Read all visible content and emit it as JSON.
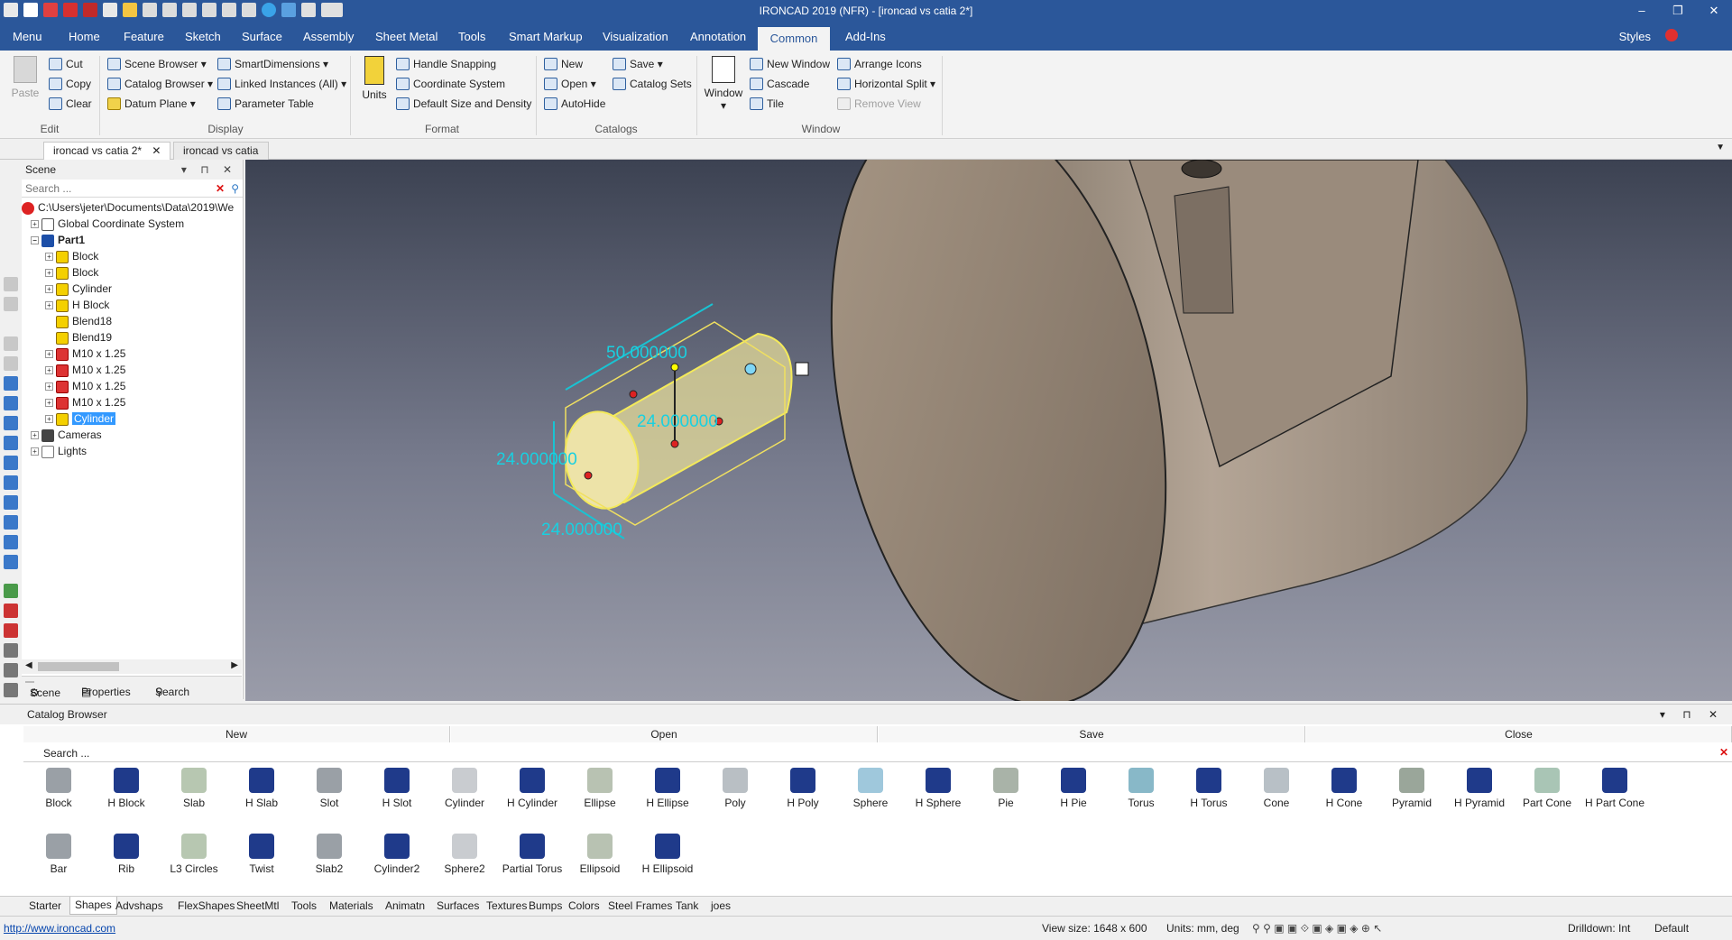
{
  "window": {
    "title": "IRONCAD 2019 (NFR) - [ironcad vs catia 2*]",
    "controls": [
      "–",
      "❐",
      "✕"
    ]
  },
  "menu": {
    "tabs": [
      "Menu",
      "Home",
      "Feature",
      "Sketch",
      "Surface",
      "Assembly",
      "Sheet Metal",
      "Tools",
      "Smart Markup",
      "Visualization",
      "Annotation",
      "Common",
      "Add-Ins"
    ],
    "active": "Common",
    "styles": "Styles"
  },
  "ribbon": {
    "edit": {
      "paste": "Paste",
      "cut": "Cut",
      "copy": "Copy",
      "clear": "Clear",
      "label": "Edit"
    },
    "display": {
      "scene_browser": "Scene Browser",
      "catalog_browser": "Catalog Browser",
      "datum_plane": "Datum Plane",
      "smart_dimensions": "SmartDimensions",
      "linked_instances": "Linked Instances (All)",
      "parameter_table": "Parameter Table",
      "label": "Display"
    },
    "format": {
      "units": "Units",
      "handle_snapping": "Handle Snapping",
      "coordinate_system": "Coordinate System",
      "default_size": "Default Size and Density",
      "label": "Format"
    },
    "catalogs": {
      "new": "New",
      "open": "Open",
      "autohide": "AutoHide",
      "save": "Save",
      "catalog_sets": "Catalog Sets",
      "label": "Catalogs"
    },
    "window": {
      "window": "Window",
      "new_window": "New Window",
      "cascade": "Cascade",
      "tile": "Tile",
      "arrange_icons": "Arrange Icons",
      "horizontal_split": "Horizontal Split",
      "remove_view": "Remove View",
      "label": "Window"
    }
  },
  "doc_tabs": [
    "ironcad vs catia 2*",
    "ironcad vs catia"
  ],
  "scene": {
    "title": "Scene",
    "search_placeholder": "Search ...",
    "root": "C:\\Users\\jeter\\Documents\\Data\\2019\\We",
    "gcs": "Global Coordinate System",
    "part": "Part1",
    "items": [
      "Block",
      "Block",
      "Cylinder",
      "H Block",
      "Blend18",
      "Blend19",
      "M10 x 1.25",
      "M10 x 1.25",
      "M10 x 1.25",
      "M10 x 1.25"
    ],
    "selected": "Cylinder",
    "cameras": "Cameras",
    "lights": "Lights",
    "tabs": {
      "scene": "Scene",
      "properties": "Properties",
      "search": "Search"
    }
  },
  "viewport": {
    "dim_length": "50.000000",
    "dim_height": "24.000000",
    "dim_width": "24.000000",
    "dim_center": "24.000000"
  },
  "catalog": {
    "title": "Catalog Browser",
    "buttons": [
      "New",
      "Open",
      "Save",
      "Close"
    ],
    "search": "Search ...",
    "row1": [
      "Block",
      "H Block",
      "Slab",
      "H Slab",
      "Slot",
      "H Slot",
      "Cylinder",
      "H Cylinder",
      "Ellipse",
      "H Ellipse",
      "Poly",
      "H Poly",
      "Sphere",
      "H Sphere",
      "Pie",
      "H Pie",
      "Torus",
      "H Torus",
      "Cone",
      "H Cone",
      "Pyramid",
      "H Pyramid",
      "Part Cone",
      "H Part Cone"
    ],
    "row2": [
      "Bar",
      "Rib",
      "L3 Circles",
      "Twist",
      "Slab2",
      "Cylinder2",
      "Sphere2",
      "Partial Torus",
      "Ellipsoid",
      "H Ellipsoid"
    ],
    "tabs": [
      "Starter",
      "Shapes",
      "Advshaps",
      "FlexShapes",
      "SheetMtl",
      "Tools",
      "Materials",
      "Animatn",
      "Surfaces",
      "Textures",
      "Bumps",
      "Colors",
      "Steel Frames",
      "Tank",
      "joes"
    ],
    "active_tab": "Shapes"
  },
  "status": {
    "url": "http://www.ironcad.com",
    "view_size": "View size: 1648 x 600",
    "units": "Units: mm, deg",
    "drilldown": "Drilldown: Int",
    "default": "Default"
  }
}
